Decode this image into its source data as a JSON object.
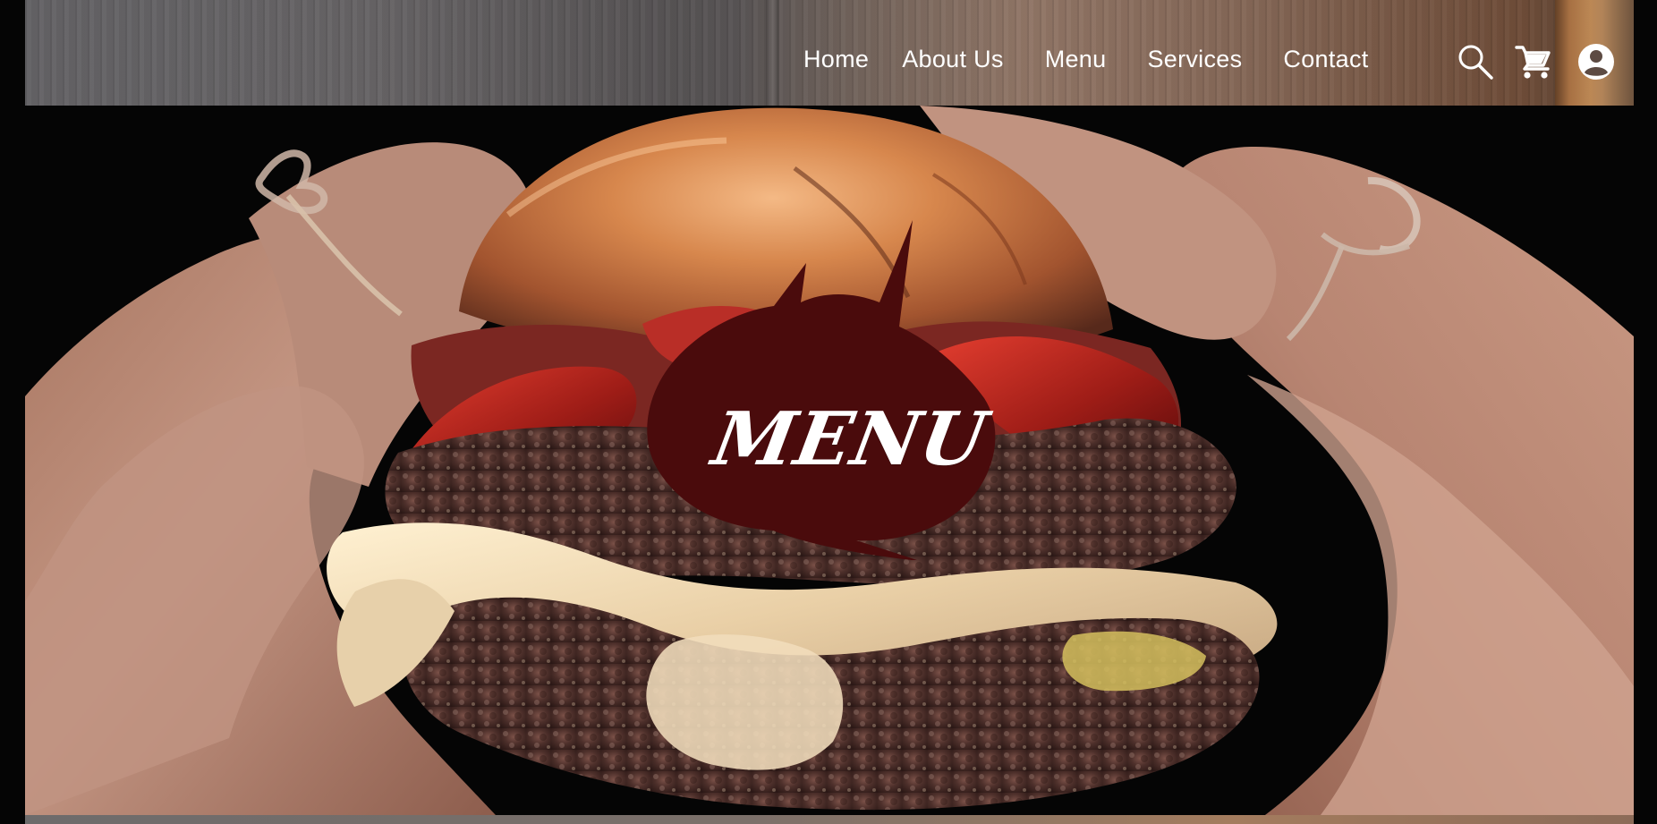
{
  "navigation": {
    "items": [
      {
        "label": "Home"
      },
      {
        "label": "About Us"
      },
      {
        "label": "Menu"
      },
      {
        "label": "Services"
      },
      {
        "label": "Contact"
      }
    ],
    "icons": [
      "search-icon",
      "cart-icon",
      "account-icon"
    ]
  },
  "hero": {
    "badge_label": "MENU",
    "image_subject": "burger-held-in-hands"
  },
  "theme": {
    "nav_text": "#ffffff",
    "badge_fill": "#4a0b0c",
    "background": "#050505"
  }
}
